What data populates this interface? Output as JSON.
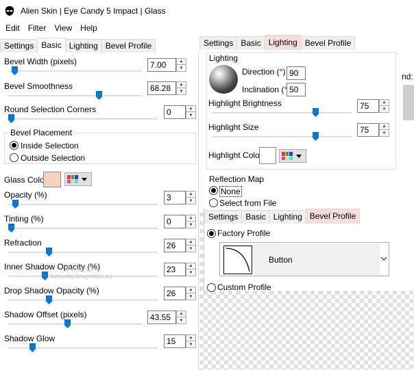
{
  "window": {
    "title": "Alien Skin | Eye Candy 5 Impact | Glass"
  },
  "menu": [
    "Edit",
    "Filter",
    "View",
    "Help"
  ],
  "left_tabs": [
    "Settings",
    "Basic",
    "Lighting",
    "Bevel Profile"
  ],
  "left": {
    "bevel_width": {
      "label": "Bevel Width (pixels)",
      "value": "7.00"
    },
    "bevel_smoothness": {
      "label": "Bevel Smoothness",
      "value": "68.28"
    },
    "round_corners": {
      "label": "Round Selection Corners",
      "value": "0"
    },
    "bevel_placement": {
      "legend": "Bevel Placement",
      "inside": "Inside Selection",
      "outside": "Outside Selection",
      "selected": "Inside Selection"
    },
    "glass_color": {
      "label": "Glass Color",
      "color": "#f9d2bd"
    },
    "opacity": {
      "label": "Opacity (%)",
      "value": "3"
    },
    "tinting": {
      "label": "Tinting (%)",
      "value": "0"
    },
    "refraction": {
      "label": "Refraction",
      "value": "26"
    },
    "inner_shadow": {
      "label": "Inner Shadow Opacity (%)",
      "value": "23"
    },
    "drop_shadow": {
      "label": "Drop Shadow Opacity (%)",
      "value": "26"
    },
    "shadow_offset": {
      "label": "Shadow Offset (pixels)",
      "value": "43.55"
    },
    "shadow_glow": {
      "label": "Shadow Glow",
      "value": "15"
    }
  },
  "right_tabs": [
    "Settings",
    "Basic",
    "Lighting",
    "Bevel Profile"
  ],
  "lighting": {
    "legend": "Lighting",
    "direction_label": "Direction (°)",
    "direction": "90",
    "inclination_label": "Inclination (°)",
    "inclination": "50",
    "highlight_brightness_label": "Highlight Brightness",
    "highlight_brightness": "75",
    "highlight_size_label": "Highlight Size",
    "highlight_size": "75",
    "highlight_color_label": "Highlight Color",
    "highlight_color": "#ffffff"
  },
  "reflection": {
    "legend": "Reflection Map",
    "none": "None",
    "file": "Select from File",
    "selected": "None"
  },
  "bevel_tabs": [
    "Settings",
    "Basic",
    "Lighting",
    "Bevel Profile"
  ],
  "bevel_profile": {
    "factory": "Factory Profile",
    "profile_name": "Button",
    "custom": "Custom Profile",
    "selected": "Factory Profile"
  },
  "partial_label": "nd:",
  "watermark": {
    "line1": "Pinuccia",
    "line2": "www.maidiragrafica.eu"
  },
  "palette_colors": [
    "#e33",
    "#3a3",
    "#33e",
    "#e3e",
    "#ee3",
    "#3ee"
  ]
}
